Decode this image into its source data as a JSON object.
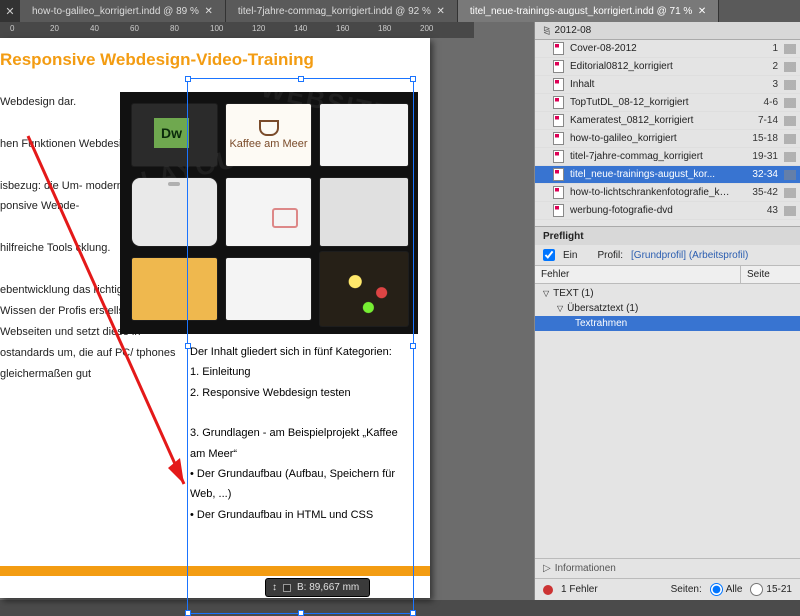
{
  "tabs": {
    "close_glyph": "✕",
    "items": [
      {
        "label": "how-to-galileo_korrigiert.indd @ 89 %",
        "close": "✕",
        "active": false
      },
      {
        "label": "titel-7jahre-commag_korrigiert.indd @ 92 %",
        "close": "✕",
        "active": false
      },
      {
        "label": "titel_neue-trainings-august_korrigiert.indd @ 71 %",
        "close": "✕",
        "active": true
      }
    ]
  },
  "ruler": {
    "marks": [
      "0",
      "20",
      "40",
      "60",
      "80",
      "100",
      "120",
      "140",
      "160",
      "180",
      "200"
    ]
  },
  "article": {
    "headline": "Responsive Webdesign-Video-Training",
    "left": {
      "p1": "Webdesign dar.",
      "p2": "hen Funktionen Webdesign wer-",
      "p3": "isbezug: die Um- modernen Web- ponsive Webde-",
      "p4": "hilfreiche Tools cklung.",
      "p5": "ebentwicklung das richtige dem Wissen der Profis erstellst Webseiten und setzt diese in ostandards um, die auf PC/ tphones gleichermaßen gut"
    },
    "hero": {
      "cafe_label": "Kaffee am Meer",
      "dw_label": "Dw"
    },
    "right": {
      "intro": "Der Inhalt gliedert sich in fünf Kategorien:",
      "l1": "1. Einleitung",
      "l2": "2. Responsive Webdesign testen",
      "l3": "3. Grundlagen - am Beispielprojekt „Kaffee am Meer“",
      "b1": "• Der Grundaufbau (Aufbau, Speichern für Web, ...)",
      "b2": "• Der Grundaufbau in HTML und CSS"
    }
  },
  "measure": {
    "label": "B: 89,667 mm"
  },
  "pages_panel": {
    "title": "2012-08",
    "rows": [
      {
        "name": "Cover-08-2012",
        "range": "1"
      },
      {
        "name": "Editorial0812_korrigiert",
        "range": "2"
      },
      {
        "name": "Inhalt",
        "range": "3"
      },
      {
        "name": "TopTutDL_08-12_korrigiert",
        "range": "4-6"
      },
      {
        "name": "Kameratest_0812_korrigiert",
        "range": "7-14"
      },
      {
        "name": "how-to-galileo_korrigiert",
        "range": "15-18"
      },
      {
        "name": "titel-7jahre-commag_korrigiert",
        "range": "19-31"
      },
      {
        "name": "titel_neue-trainings-august_kor...",
        "range": "32-34",
        "selected": true
      },
      {
        "name": "how-to-lichtschrankenfotografie_korrigiert",
        "range": "35-42"
      },
      {
        "name": "werbung-fotografie-dvd",
        "range": "43"
      }
    ]
  },
  "preflight": {
    "tab": "Preflight",
    "ein_label": "Ein",
    "profil_label": "Profil:",
    "profil_value": "[Grundprofil] (Arbeitsprofil)",
    "col_error": "Fehler",
    "col_page": "Seite",
    "tree": {
      "n1": "TEXT (1)",
      "n2": "Übersatztext (1)",
      "n3": "Textrahmen"
    },
    "info_label": "Informationen",
    "status_text": "1 Fehler",
    "seiten_label": "Seiten:",
    "alle_label": "Alle",
    "range_value": "15-21"
  }
}
